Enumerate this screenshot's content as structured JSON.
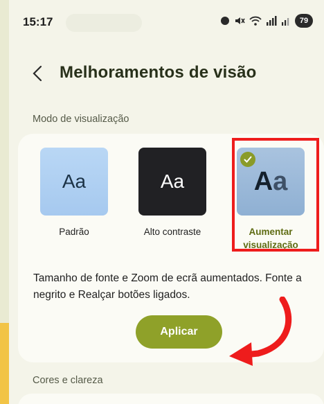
{
  "status_bar": {
    "time": "15:17",
    "battery": "79",
    "icons": [
      "dot-icon",
      "mute-icon",
      "wifi-icon",
      "signal-icon",
      "signal-icon-2",
      "battery-icon"
    ]
  },
  "header": {
    "back_icon": "chevron-left-icon",
    "title": "Melhoramentos de visão"
  },
  "sections": {
    "view_mode_label": "Modo de visualização",
    "colors_label": "Cores e clareza"
  },
  "modes": [
    {
      "tile_text": "Aa",
      "label": "Padrão",
      "selected": false
    },
    {
      "tile_text": "Aa",
      "label": "Alto contraste",
      "selected": false
    },
    {
      "tile_text_a": "A",
      "tile_text_b": "a",
      "label_line1": "Aumentar",
      "label_line2": "visualização",
      "selected": true
    }
  ],
  "description": "Tamanho de fonte e Zoom de ecrã aumentados. Fonte a negrito e Realçar botões ligados.",
  "apply_button": "Aplicar",
  "colors": {
    "accent": "#8fa129",
    "highlight": "#ee1c1c",
    "background": "#f4f4e9",
    "card": "#fbfbf5"
  }
}
